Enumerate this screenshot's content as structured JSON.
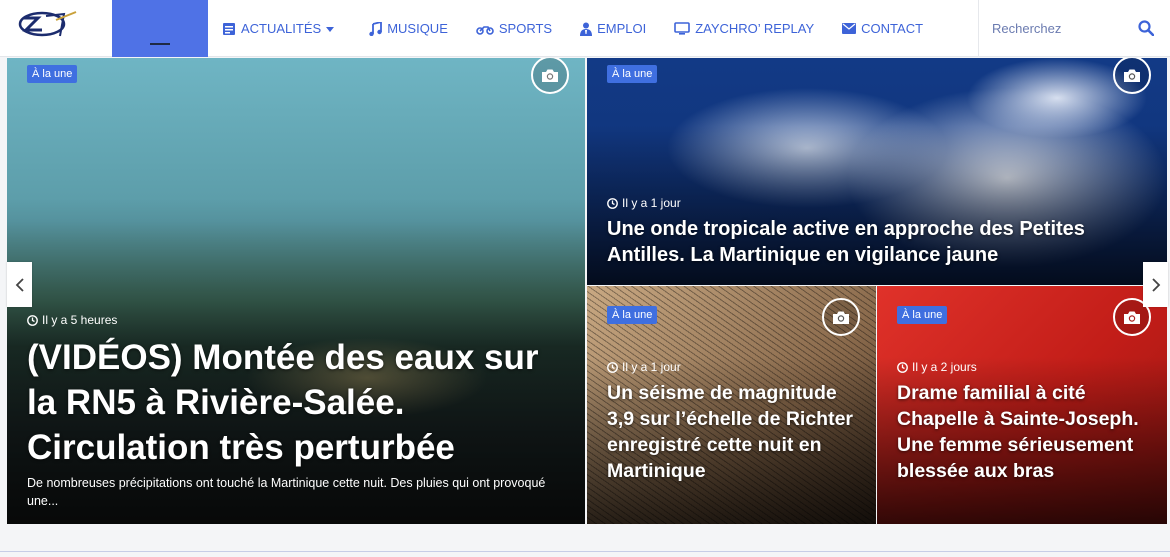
{
  "header": {
    "logo_alt": "Zaychro logo",
    "nav": [
      {
        "label": "ACTUALITÉS",
        "icon": "newspaper-icon",
        "dropdown": true
      },
      {
        "label": "MUSIQUE",
        "icon": "music-icon"
      },
      {
        "label": "SPORTS",
        "icon": "motorcycle-icon"
      },
      {
        "label": "EMPLOI",
        "icon": "user-tie-icon"
      },
      {
        "label": "ZAYCHRO’ REPLAY",
        "icon": "tv-icon"
      },
      {
        "label": "CONTACT",
        "icon": "envelope-icon"
      }
    ],
    "search": {
      "placeholder": "Recherchez"
    }
  },
  "cards": [
    {
      "badge": "À la une",
      "time": "Il y a 5 heures",
      "title": "(VIDÉOS) Montée des eaux sur la RN5 à Rivière-Salée. Circulation très perturbée",
      "excerpt": "De nombreuses précipitations ont touché la Martinique cette nuit. Des pluies qui ont provoqué une..."
    },
    {
      "badge": "À la une",
      "time": "Il y a 1 jour",
      "title": "Une onde tropicale active en approche des Petites Antilles. La Martinique en vigilance jaune"
    },
    {
      "badge": "À la une",
      "time": "Il y a 1 jour",
      "title": "Un séisme de magnitude 3,9 sur l’échelle de Richter enregistré cette nuit en Martinique"
    },
    {
      "badge": "À la une",
      "time": "Il y a 2 jours",
      "title": "Drame familial à cité Chapelle à Sainte-Joseph. Une femme sérieusement blessée aux bras"
    }
  ],
  "colors": {
    "accent": "#3f6fe0",
    "nav_text": "#3d63d8"
  }
}
